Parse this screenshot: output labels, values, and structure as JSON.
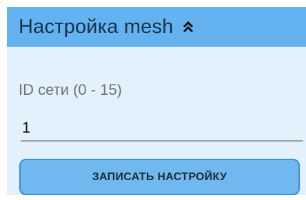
{
  "section": {
    "title": "Настройка mesh",
    "collapse_icon": "double-chevron-up-icon",
    "colors": {
      "header_bg": "#64b2ef",
      "body_bg": "#e3f1fc",
      "button_bg": "#70b9f0",
      "button_border": "#3d8fd0"
    }
  },
  "mesh_id": {
    "label": "ID сети (0 - 15)",
    "value": "1"
  },
  "actions": {
    "save_label": "ЗАПИСАТЬ НАСТРОЙКУ"
  }
}
